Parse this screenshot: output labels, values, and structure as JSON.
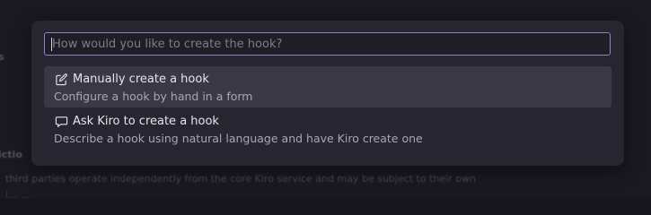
{
  "background": {
    "fragments": [
      "s",
      "ictio",
      "third parties operate independently from the core Kiro service and may be subject to their own",
      "l... ..."
    ]
  },
  "palette": {
    "placeholder": "How would you like to create the hook?",
    "value": "",
    "options": [
      {
        "icon": "edit-icon",
        "title": "Manually create a hook",
        "description": "Configure a hook by hand in a form",
        "selected": true
      },
      {
        "icon": "chat-bubble-icon",
        "title": "Ask Kiro to create a hook",
        "description": "Describe a hook using natural language and have Kiro create one",
        "selected": false
      }
    ]
  },
  "colors": {
    "accent": "#8b82c8",
    "panel": "#27252f",
    "selected": "#3a3845"
  }
}
